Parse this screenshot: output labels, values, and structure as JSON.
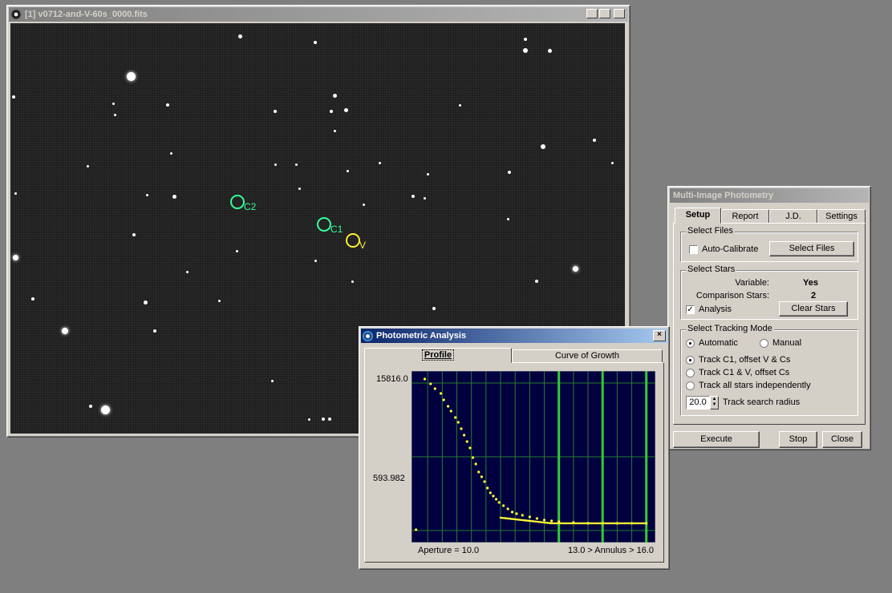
{
  "fits_window": {
    "title": "[1] v0712-and-V-60s_0000.fits",
    "minimize": "_",
    "maximize": "□",
    "close": "×",
    "markers": [
      {
        "label": "C2",
        "color": "#33ff99"
      },
      {
        "label": "C1",
        "color": "#33ff99"
      },
      {
        "label": "V",
        "color": "#ffee33"
      }
    ]
  },
  "mip": {
    "title": "Multi-Image Photometry",
    "tabs": [
      "Setup",
      "Report",
      "J.D.",
      "Settings"
    ],
    "active_tab": "Setup",
    "select_files": {
      "group_title": "Select Files",
      "auto_calibrate_label": "Auto-Calibrate",
      "auto_calibrate_checked": false,
      "select_files_button": "Select Files"
    },
    "select_stars": {
      "group_title": "Select Stars",
      "variable_label": "Variable:",
      "variable_value": "Yes",
      "comparison_label": "Comparison Stars:",
      "comparison_value": "2",
      "analysis_label": "Analysis",
      "analysis_checked": true,
      "clear_stars_button": "Clear Stars"
    },
    "tracking": {
      "group_title": "Select Tracking Mode",
      "automatic_label": "Automatic",
      "manual_label": "Manual",
      "mode": "Automatic",
      "opt1": "Track C1, offset V & Cs",
      "opt2": "Track C1 & V, offset Cs",
      "opt3": "Track all stars independently",
      "selected_option": 1,
      "radius_value": "20.0",
      "radius_label": "Track search radius"
    },
    "execute_button": "Execute",
    "stop_button": "Stop",
    "close_button": "Close"
  },
  "photometric": {
    "title": "Photometric Analysis",
    "close": "×",
    "tabs": [
      "Profile",
      "Curve of Growth"
    ],
    "active_tab": "Profile",
    "y_top_label": "15816.0",
    "y_mid_label": "593.982",
    "aperture_label": "Aperture = 10.0",
    "annulus_label": "13.0 > Annulus > 16.0"
  },
  "chart_data": {
    "type": "scatter",
    "title": "",
    "series": [
      {
        "values": [
          [
            0.2,
            0.05
          ],
          [
            0.8,
            0.99
          ],
          [
            1.2,
            0.96
          ],
          [
            1.5,
            0.93
          ],
          [
            1.9,
            0.9
          ],
          [
            2.1,
            0.86
          ],
          [
            2.4,
            0.82
          ],
          [
            2.6,
            0.79
          ],
          [
            2.9,
            0.75
          ],
          [
            3.1,
            0.72
          ],
          [
            3.3,
            0.68
          ],
          [
            3.5,
            0.64
          ],
          [
            3.7,
            0.6
          ],
          [
            3.9,
            0.56
          ],
          [
            4.1,
            0.5
          ],
          [
            4.3,
            0.46
          ],
          [
            4.5,
            0.41
          ],
          [
            4.7,
            0.38
          ],
          [
            4.9,
            0.35
          ],
          [
            5.1,
            0.31
          ],
          [
            5.3,
            0.28
          ],
          [
            5.5,
            0.26
          ],
          [
            5.7,
            0.24
          ],
          [
            5.9,
            0.22
          ],
          [
            6.2,
            0.2
          ],
          [
            6.5,
            0.18
          ],
          [
            6.8,
            0.16
          ],
          [
            7.1,
            0.15
          ],
          [
            7.5,
            0.14
          ],
          [
            8.0,
            0.13
          ],
          [
            8.5,
            0.12
          ],
          [
            9.0,
            0.11
          ],
          [
            9.5,
            0.105
          ],
          [
            10.0,
            0.1
          ],
          [
            11.0,
            0.095
          ],
          [
            12.0,
            0.09
          ],
          [
            13.0,
            0.09
          ],
          [
            14.0,
            0.09
          ],
          [
            15.0,
            0.09
          ],
          [
            16.0,
            0.09
          ]
        ],
        "color": "#ffff33"
      }
    ],
    "xlim": [
      0,
      16.4
    ],
    "aperture": 10.0,
    "annulus_inner": 13.0,
    "annulus_outer": 16.0,
    "background": "#000040",
    "grid": true
  }
}
